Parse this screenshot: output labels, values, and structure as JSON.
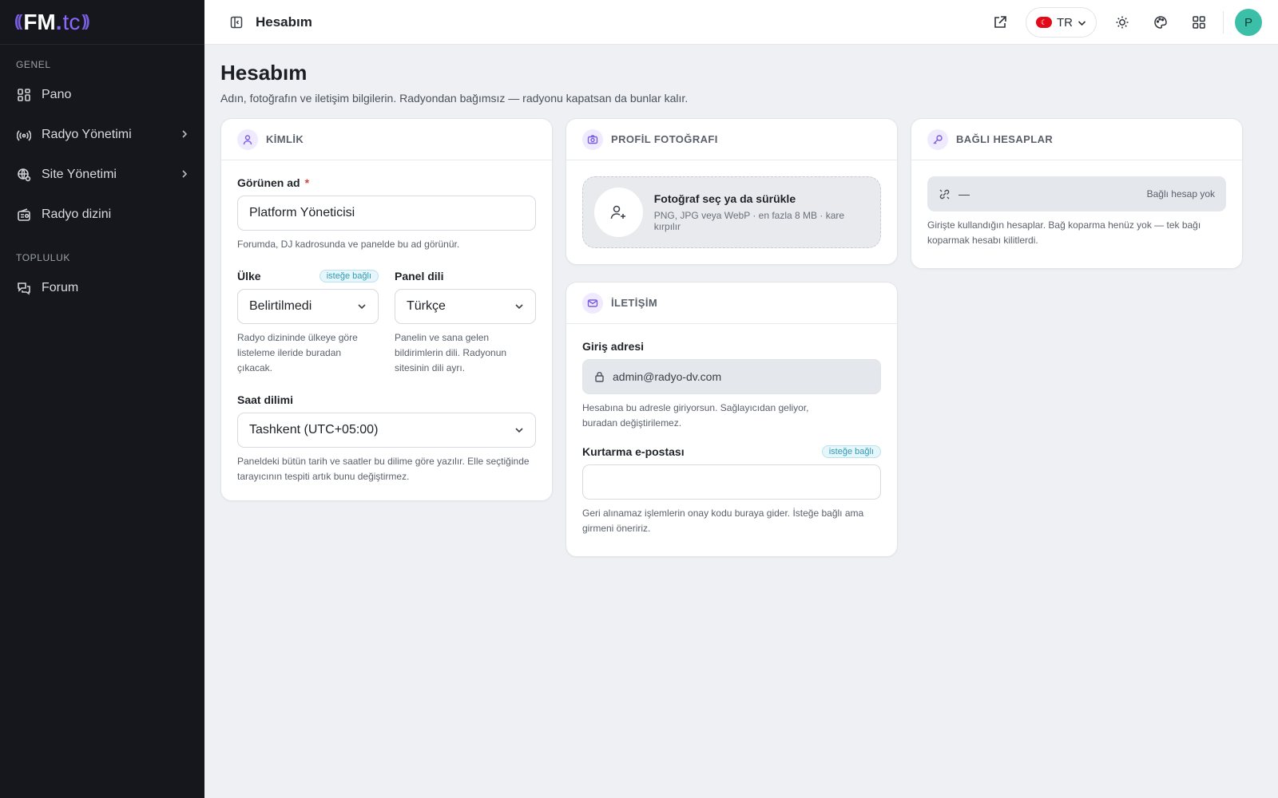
{
  "brand": {
    "fm": "FM",
    "dot": ".",
    "tc": "tc"
  },
  "sidebar": {
    "sections": [
      {
        "title": "GENEL",
        "items": [
          {
            "label": "Pano",
            "icon": "dashboard-icon",
            "has_children": false
          },
          {
            "label": "Radyo Yönetimi",
            "icon": "broadcast-icon",
            "has_children": true
          },
          {
            "label": "Site Yönetimi",
            "icon": "globe-settings-icon",
            "has_children": true
          },
          {
            "label": "Radyo dizini",
            "icon": "radio-icon",
            "has_children": false
          }
        ]
      },
      {
        "title": "TOPLULUK",
        "items": [
          {
            "label": "Forum",
            "icon": "forum-icon",
            "has_children": false
          }
        ]
      }
    ]
  },
  "topbar": {
    "title": "Hesabım",
    "language_code": "TR",
    "avatar_initial": "P"
  },
  "page": {
    "title": "Hesabım",
    "subtitle": "Adın, fotoğrafın ve iletişim bilgilerin. Radyondan bağımsız — radyonu kapatsan da bunlar kalır."
  },
  "identity": {
    "header": "KİMLİK",
    "display_name_label": "Görünen ad",
    "required_mark": "*",
    "display_name_value": "Platform Yöneticisi",
    "display_name_help": "Forumda, DJ kadrosunda ve panelde bu ad görünür.",
    "country_label": "Ülke",
    "optional_badge": "isteğe bağlı",
    "country_value": "Belirtilmedi",
    "country_help": "Radyo dizininde ülkeye göre listeleme ileride buradan çıkacak.",
    "panel_lang_label": "Panel dili",
    "panel_lang_value": "Türkçe",
    "panel_lang_help": "Panelin ve sana gelen bildirimlerin dili. Radyonun sitesinin dili ayrı.",
    "timezone_label": "Saat dilimi",
    "timezone_value": "Tashkent (UTC+05:00)",
    "timezone_help": "Paneldeki bütün tarih ve saatler bu dilime göre yazılır. Elle seçtiğinde tarayıcının tespiti artık bunu değiştirmez."
  },
  "photo": {
    "header": "PROFİL FOTOĞRAFI",
    "dropzone_title": "Fotoğraf seç ya da sürükle",
    "dropzone_sub": "PNG, JPG veya WebP · en fazla 8 MB · kare kırpılır"
  },
  "contact": {
    "header": "İLETİŞİM",
    "login_label": "Giriş adresi",
    "login_value": "admin@radyo-dv.com",
    "login_help": "Hesabına bu adresle giriyorsun. Sağlayıcıdan geliyor, buradan değiştirilemez.",
    "recovery_label": "Kurtarma e-postası",
    "optional_badge": "isteğe bağlı",
    "recovery_value": "",
    "recovery_help": "Geri alınamaz işlemlerin onay kodu buraya gider. İsteğe bağlı ama girmeni öneririz."
  },
  "linked": {
    "header": "BAĞLI HESAPLAR",
    "row_dash": "—",
    "row_status": "Bağlı hesap yok",
    "help": "Girişte kullandığın hesaplar. Bağ koparma henüz yok — tek bağı koparmak hesabı kilitlerdi."
  }
}
